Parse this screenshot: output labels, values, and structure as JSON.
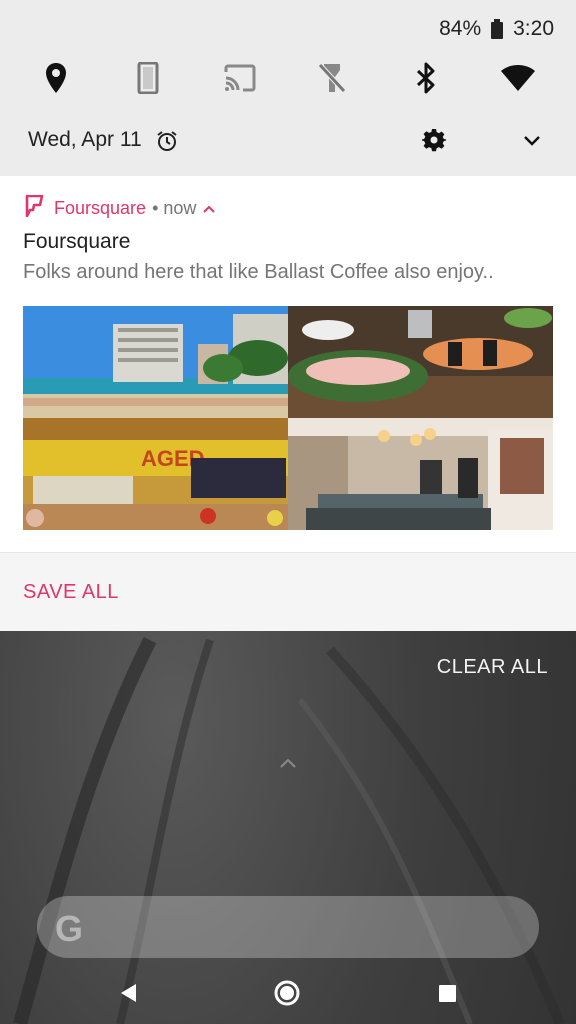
{
  "status_bar": {
    "battery": "84%",
    "time": "3:20",
    "icons": [
      "battery-icon"
    ]
  },
  "quick_settings": {
    "tiles": [
      "location-icon",
      "rotation-icon",
      "cast-icon",
      "flashlight-off-icon",
      "bluetooth-icon",
      "wifi-icon"
    ],
    "date": "Wed, Apr 11",
    "date_icons": [
      "alarm-icon",
      "gear-icon",
      "chevron-down-icon"
    ]
  },
  "notification": {
    "app_name": "Foursquare",
    "separator_time": "• now",
    "title": "Foursquare",
    "text": "Folks around here that like Ballast Coffee also enjoy..",
    "accent_color": "#e0366c",
    "images": [
      "beach-photo",
      "sushi-photo",
      "market-photo",
      "coffee-shop-photo"
    ],
    "action": "SAVE ALL"
  },
  "clear_all": "CLEAR ALL",
  "search": {
    "logo": "G"
  },
  "nav": [
    "back-icon",
    "home-icon",
    "recents-icon"
  ]
}
